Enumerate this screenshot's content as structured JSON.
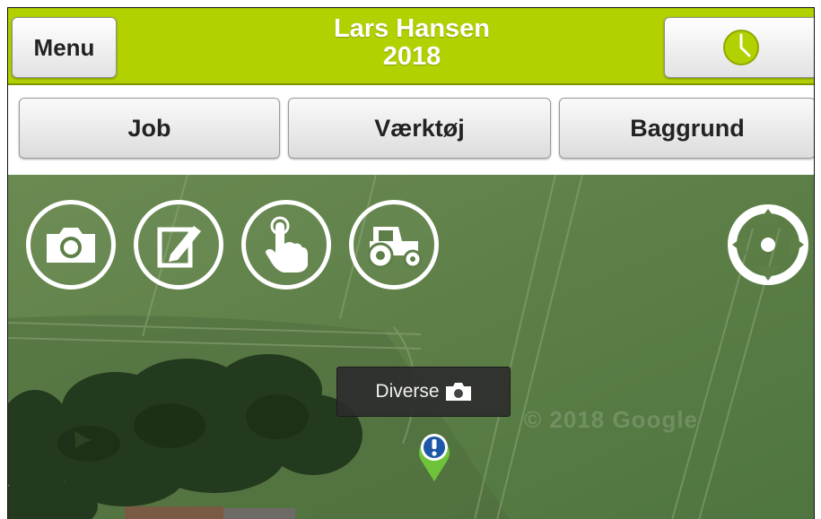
{
  "header": {
    "menu_label": "Menu",
    "user_name": "Lars Hansen",
    "year": "2018",
    "clock_icon": "clock-icon"
  },
  "tabs": [
    {
      "label": "Job"
    },
    {
      "label": "Værktøj"
    },
    {
      "label": "Baggrund"
    }
  ],
  "map": {
    "tools": [
      "camera-icon",
      "note-edit-icon",
      "touch-hand-icon",
      "tractor-icon"
    ],
    "locate_icon": "crosshair-locate-icon",
    "marker": {
      "label": "Diverse",
      "label_icon": "camera-icon",
      "pin_icon": "exclamation-pin-icon"
    },
    "watermark": "© 2018 Google"
  },
  "colors": {
    "accent": "#b3d000",
    "pin_blue": "#1d57a8",
    "pin_green": "#6fc33b"
  }
}
